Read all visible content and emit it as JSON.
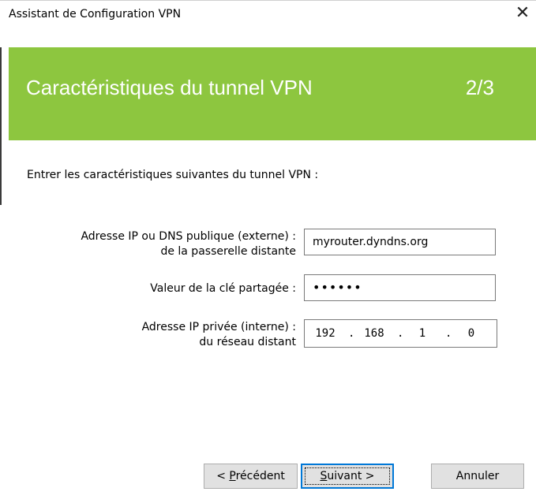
{
  "window": {
    "title": "Assistant de Configuration VPN",
    "close_glyph": "✕"
  },
  "banner": {
    "title": "Caractéristiques du tunnel VPN",
    "step": "2/3",
    "color": "#8dc63f"
  },
  "intro": "Entrer les caractéristiques suivantes du tunnel VPN :",
  "form": {
    "public_ip": {
      "label_line1": "Adresse IP ou DNS publique (externe) :",
      "label_line2": "de la passerelle distante",
      "value": "myrouter.dyndns.org"
    },
    "shared_key": {
      "label": "Valeur de la clé partagée :",
      "value": "••••••"
    },
    "private_ip": {
      "label_line1": "Adresse IP privée (interne) :",
      "label_line2": "du réseau distant",
      "octets": [
        "192",
        "168",
        "1",
        "0"
      ],
      "separator": "."
    }
  },
  "buttons": {
    "previous": {
      "prefix": "< ",
      "mnemonic": "P",
      "rest": "récédent"
    },
    "next": {
      "mnemonic": "S",
      "rest": "uivant >"
    },
    "cancel": "Annuler"
  }
}
